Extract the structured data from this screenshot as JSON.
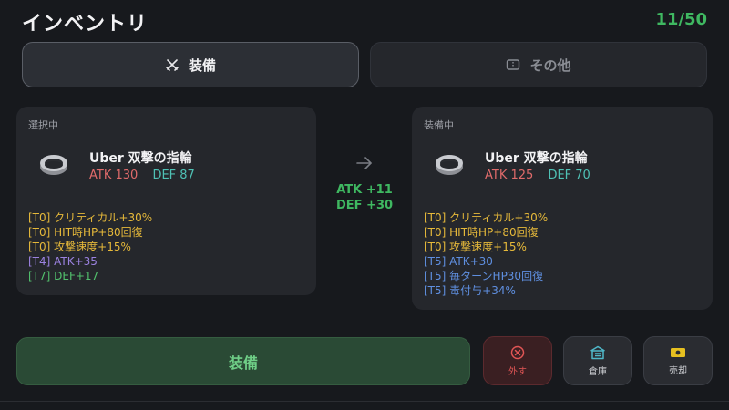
{
  "header": {
    "title": "インベントリ",
    "count": "11/50"
  },
  "tabs": [
    {
      "label": "装備",
      "icon": "crossed-swords-icon",
      "active": true
    },
    {
      "label": "その他",
      "icon": "ticket-icon",
      "active": false
    }
  ],
  "selected": {
    "label": "選択中",
    "name": "Uber 双撃の指輪",
    "atk": "ATK 130",
    "def": "DEF 87",
    "mods": [
      {
        "text": "[T0] クリティカル+30%",
        "color": "#e6b93a"
      },
      {
        "text": "[T0] HIT時HP+80回復",
        "color": "#e6b93a"
      },
      {
        "text": "[T0] 攻撃速度+15%",
        "color": "#e6b93a"
      },
      {
        "text": "[T4] ATK+35",
        "color": "#9b82e0"
      },
      {
        "text": "[T7] DEF+17",
        "color": "#52c06d"
      }
    ]
  },
  "comparison": {
    "atk_diff": "ATK +11",
    "def_diff": "DEF +30"
  },
  "equipped": {
    "label": "装備中",
    "name": "Uber 双撃の指輪",
    "atk": "ATK 125",
    "def": "DEF 70",
    "mods": [
      {
        "text": "[T0] クリティカル+30%",
        "color": "#e6b93a"
      },
      {
        "text": "[T0] HIT時HP+80回復",
        "color": "#e6b93a"
      },
      {
        "text": "[T0] 攻撃速度+15%",
        "color": "#e6b93a"
      },
      {
        "text": "[T5] ATK+30",
        "color": "#5f8fe0"
      },
      {
        "text": "[T5] 毎ターンHP30回復",
        "color": "#5f8fe0"
      },
      {
        "text": "[T5] 毒付与+34%",
        "color": "#5f8fe0"
      }
    ]
  },
  "actions": {
    "equip_label": "装備",
    "remove_label": "外す",
    "storage_label": "倉庫",
    "sell_label": "売却"
  },
  "colors": {
    "accent_green": "#3fb861",
    "danger": "#e05555",
    "atk": "#e06b6b",
    "def": "#4fc1b5"
  }
}
